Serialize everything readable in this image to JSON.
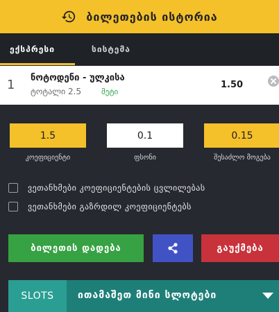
{
  "header": {
    "title": "ბილეთების ისტორია",
    "icon": "history-icon"
  },
  "tabs": [
    {
      "label": "ექსპრესი",
      "active": true
    },
    {
      "label": "სისტემა",
      "active": false
    }
  ],
  "bet": {
    "index": "1",
    "match": "ნოტოდენი - ულკისა",
    "market": "ტოტალი 2.5",
    "outcome": "მეტი",
    "odds": "1.50"
  },
  "inputs": {
    "coefficient": {
      "value": "1.5",
      "label": "კოეფიციენტი"
    },
    "stake": {
      "value": "0.1",
      "label": "ფსონი"
    },
    "payout": {
      "value": "0.15",
      "label": "შესაძლო მოგება"
    }
  },
  "options": [
    {
      "label": "ვეთანხმები კოეფიციენტების ცვლილებას",
      "checked": false
    },
    {
      "label": "ვეთანხმები გაზრდილ კოეფიციენტებს",
      "checked": false
    }
  ],
  "actions": {
    "place": "ბილეთის დადება",
    "share_icon": "share-icon",
    "clear": "გაუქმება"
  },
  "slots": {
    "label": "SLOTS",
    "game": "ითამაშეთ მინი სლოტები"
  },
  "colors": {
    "accent": "#f4c12b",
    "place": "#37a243",
    "share": "#4153c4",
    "clear": "#c8323a",
    "slots": "#1e7f78"
  }
}
